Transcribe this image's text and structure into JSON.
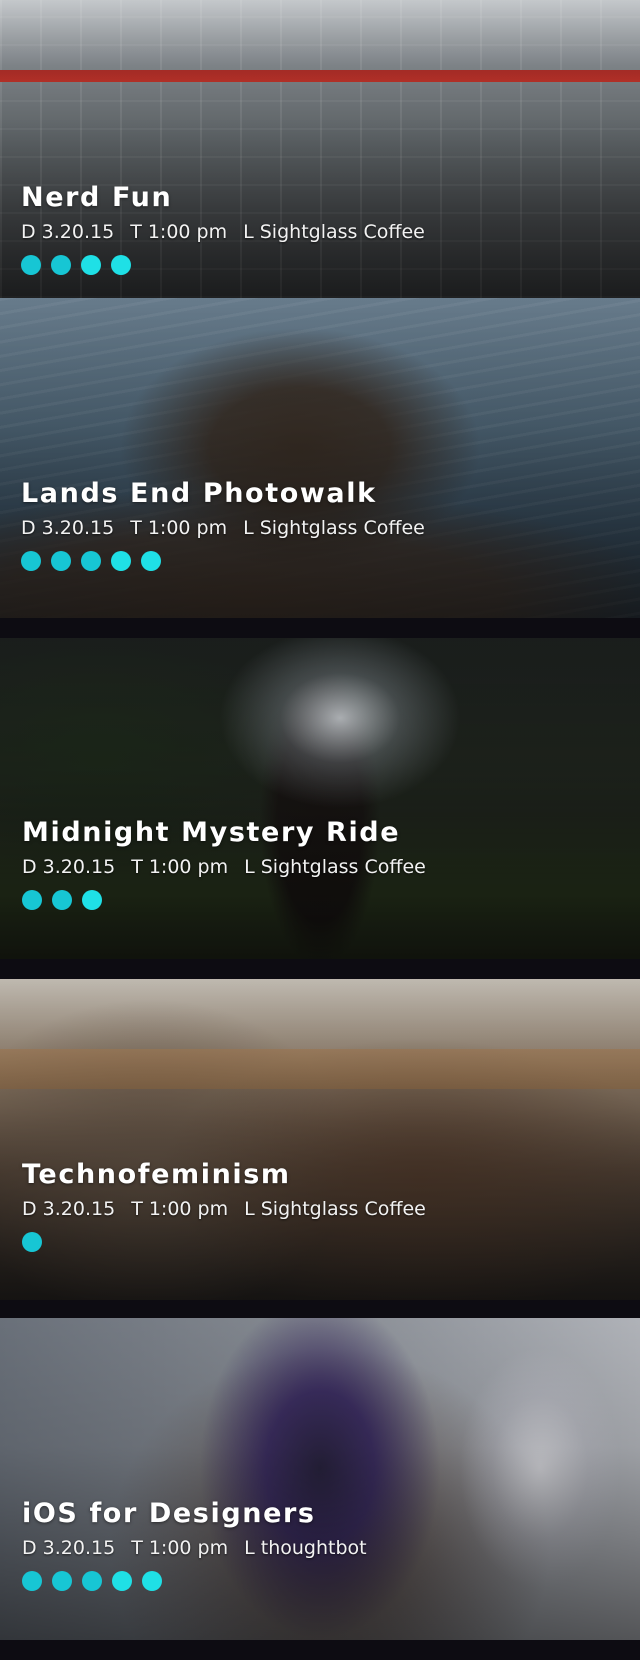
{
  "theme": {
    "dot_color": "#17c6d4",
    "dot_color_bright": "#1fe0e6",
    "background": "#0d0c12",
    "text_color": "#ffffff"
  },
  "events": [
    {
      "title": "Nerd Fun",
      "date": "D 3.20.15",
      "time": "T 1:00 pm",
      "location": "L Sightglass Coffee",
      "dots": 4
    },
    {
      "title": "Lands End Photowalk",
      "date": "D 3.20.15",
      "time": "T 1:00 pm",
      "location": "L Sightglass Coffee",
      "dots": 5
    },
    {
      "title": "Midnight Mystery Ride",
      "date": "D 3.20.15",
      "time": "T 1:00 pm",
      "location": "L Sightglass Coffee",
      "dots": 3
    },
    {
      "title": "Technofeminism",
      "date": "D 3.20.15",
      "time": "T 1:00 pm",
      "location": "L Sightglass Coffee",
      "dots": 1
    },
    {
      "title": "iOS for Designers",
      "date": "D 3.20.15",
      "time": "T 1:00 pm",
      "location": "L thoughtbot",
      "dots": 5
    }
  ]
}
